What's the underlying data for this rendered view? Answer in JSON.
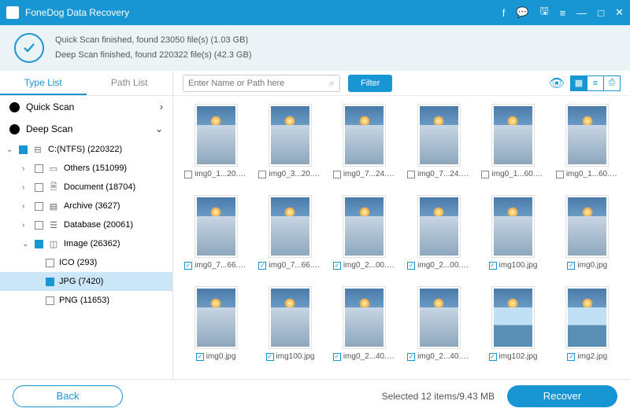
{
  "app": {
    "title": "FoneDog Data Recovery"
  },
  "status": {
    "line1": "Quick Scan finished, found 23050 file(s) (1.03 GB)",
    "line2": "Deep Scan finished, found 220322 file(s) (42.3 GB)"
  },
  "tabs": {
    "type_list": "Type List",
    "path_list": "Path List"
  },
  "scanSections": {
    "quick": "Quick Scan",
    "deep": "Deep Scan"
  },
  "tree": {
    "drive": "C:(NTFS) (220322)",
    "others": "Others (151099)",
    "document": "Document (18704)",
    "archive": "Archive (3627)",
    "database": "Database (20061)",
    "image": "Image (26362)",
    "ico": "ICO (293)",
    "jpg": "JPG (7420)",
    "png": "PNG (11653)"
  },
  "toolbar": {
    "search_placeholder": "Enter Name or Path here",
    "filter": "Filter"
  },
  "grid": [
    {
      "name": "img0_1...20.jpg",
      "checked": false,
      "variant": "sky"
    },
    {
      "name": "img0_3...20.jpg",
      "checked": false,
      "variant": "sky"
    },
    {
      "name": "img0_7...24.jpg",
      "checked": false,
      "variant": "sky"
    },
    {
      "name": "img0_7...24.jpg",
      "checked": false,
      "variant": "sky"
    },
    {
      "name": "img0_1...60.jpg",
      "checked": false,
      "variant": "sky"
    },
    {
      "name": "img0_1...60.jpg",
      "checked": false,
      "variant": "sky"
    },
    {
      "name": "img0_7...66.jpg",
      "checked": true,
      "variant": "sky"
    },
    {
      "name": "img0_7...66.jpg",
      "checked": true,
      "variant": "sky"
    },
    {
      "name": "img0_2...00.jpg",
      "checked": true,
      "variant": "sky"
    },
    {
      "name": "img0_2...00.jpg",
      "checked": true,
      "variant": "sky"
    },
    {
      "name": "img100.jpg",
      "checked": true,
      "variant": "sky"
    },
    {
      "name": "img0.jpg",
      "checked": true,
      "variant": "sky"
    },
    {
      "name": "img0.jpg",
      "checked": true,
      "variant": "sky"
    },
    {
      "name": "img100.jpg",
      "checked": true,
      "variant": "sky"
    },
    {
      "name": "img0_2...40.jpg",
      "checked": true,
      "variant": "sky"
    },
    {
      "name": "img0_2...40.jpg",
      "checked": true,
      "variant": "sky"
    },
    {
      "name": "img102.jpg",
      "checked": true,
      "variant": "island"
    },
    {
      "name": "img2.jpg",
      "checked": true,
      "variant": "island"
    }
  ],
  "footer": {
    "back": "Back",
    "selected": "Selected 12 items/9.43 MB",
    "recover": "Recover"
  }
}
